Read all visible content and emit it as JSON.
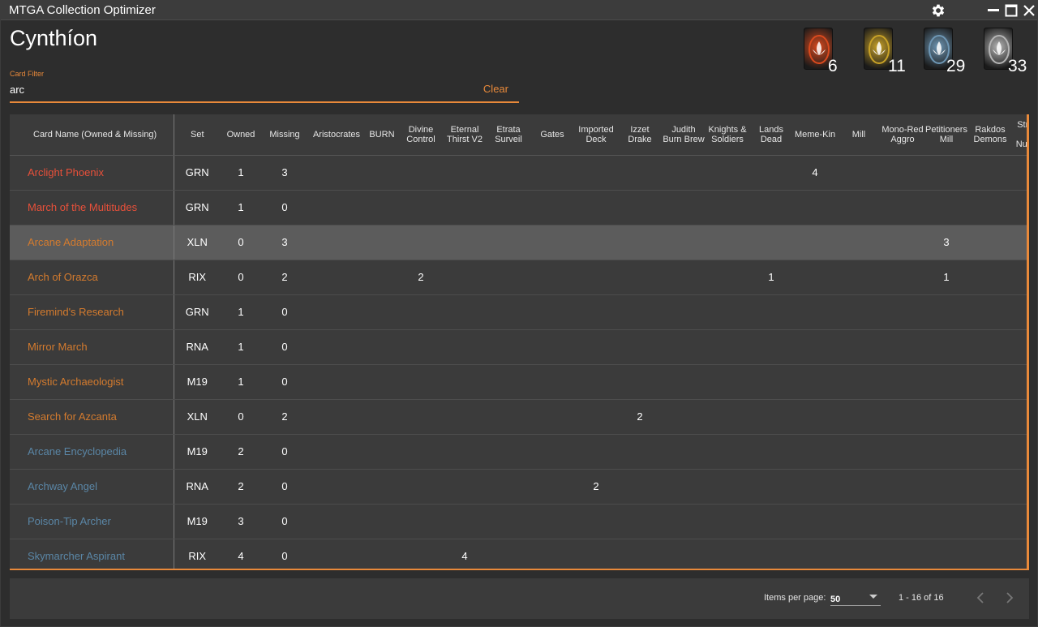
{
  "window": {
    "title": "MTGA Collection Optimizer"
  },
  "header": {
    "player_name": "Cynthíon"
  },
  "filter": {
    "label": "Card Filter",
    "value": "arc",
    "clear_label": "Clear"
  },
  "wildcards": [
    {
      "rarity": "mythic",
      "count": "6",
      "color": "#d94a1e"
    },
    {
      "rarity": "rare",
      "count": "11",
      "color": "#c9a227"
    },
    {
      "rarity": "uncommon",
      "count": "29",
      "color": "#6e97b5"
    },
    {
      "rarity": "common",
      "count": "33",
      "color": "#b5b5b5"
    }
  ],
  "table": {
    "columns": [
      {
        "label": "Card Name (Owned & Missing)"
      },
      {
        "label": "Set"
      },
      {
        "label": "Owned"
      },
      {
        "label": "Missing"
      },
      {
        "label": "Aristocrates"
      },
      {
        "label": "BURN"
      },
      {
        "label": "Divine Control"
      },
      {
        "label": "Eternal Thirst V2"
      },
      {
        "label": "Etrata Surveil"
      },
      {
        "label": "Gates"
      },
      {
        "label": "Imported Deck"
      },
      {
        "label": "Izzet Drake"
      },
      {
        "label": "Judith Burn Brew"
      },
      {
        "label": "Knights & Soldiers"
      },
      {
        "label": "Lands Dead"
      },
      {
        "label": "Meme-Kin"
      },
      {
        "label": "Mill"
      },
      {
        "label": "Mono-Red Aggro"
      },
      {
        "label": "Petitioners Mill"
      },
      {
        "label": "Rakdos Demons"
      },
      {
        "label": "Strength in Numbers"
      }
    ],
    "rows": [
      {
        "rarity": "mythic",
        "highlighted": false,
        "cells": [
          "Arclight Phoenix",
          "GRN",
          "1",
          "3",
          "",
          "",
          "",
          "",
          "",
          "",
          "",
          "",
          "",
          "",
          "",
          "4",
          "",
          "",
          "",
          "",
          ""
        ]
      },
      {
        "rarity": "mythic",
        "highlighted": false,
        "cells": [
          "March of the Multitudes",
          "GRN",
          "1",
          "0",
          "",
          "",
          "",
          "",
          "",
          "",
          "",
          "",
          "",
          "",
          "",
          "",
          "",
          "",
          "",
          "",
          ""
        ]
      },
      {
        "rarity": "rare",
        "highlighted": true,
        "cells": [
          "Arcane Adaptation",
          "XLN",
          "0",
          "3",
          "",
          "",
          "",
          "",
          "",
          "",
          "",
          "",
          "",
          "",
          "",
          "",
          "",
          "",
          "3",
          "",
          ""
        ]
      },
      {
        "rarity": "rare",
        "highlighted": false,
        "cells": [
          "Arch of Orazca",
          "RIX",
          "0",
          "2",
          "",
          "",
          "2",
          "",
          "",
          "",
          "",
          "",
          "",
          "",
          "1",
          "",
          "",
          "",
          "1",
          "",
          ""
        ]
      },
      {
        "rarity": "rare",
        "highlighted": false,
        "cells": [
          "Firemind's Research",
          "GRN",
          "1",
          "0",
          "",
          "",
          "",
          "",
          "",
          "",
          "",
          "",
          "",
          "",
          "",
          "",
          "",
          "",
          "",
          "",
          ""
        ]
      },
      {
        "rarity": "rare",
        "highlighted": false,
        "cells": [
          "Mirror March",
          "RNA",
          "1",
          "0",
          "",
          "",
          "",
          "",
          "",
          "",
          "",
          "",
          "",
          "",
          "",
          "",
          "",
          "",
          "",
          "",
          ""
        ]
      },
      {
        "rarity": "rare",
        "highlighted": false,
        "cells": [
          "Mystic Archaeologist",
          "M19",
          "1",
          "0",
          "",
          "",
          "",
          "",
          "",
          "",
          "",
          "",
          "",
          "",
          "",
          "",
          "",
          "",
          "",
          "",
          ""
        ]
      },
      {
        "rarity": "rare",
        "highlighted": false,
        "cells": [
          "Search for Azcanta",
          "XLN",
          "0",
          "2",
          "",
          "",
          "",
          "",
          "",
          "",
          "",
          "2",
          "",
          "",
          "",
          "",
          "",
          "",
          "",
          "",
          ""
        ]
      },
      {
        "rarity": "uncommon",
        "highlighted": false,
        "cells": [
          "Arcane Encyclopedia",
          "M19",
          "2",
          "0",
          "",
          "",
          "",
          "",
          "",
          "",
          "",
          "",
          "",
          "",
          "",
          "",
          "",
          "",
          "",
          "",
          ""
        ]
      },
      {
        "rarity": "uncommon",
        "highlighted": false,
        "cells": [
          "Archway Angel",
          "RNA",
          "2",
          "0",
          "",
          "",
          "",
          "",
          "",
          "",
          "2",
          "",
          "",
          "",
          "",
          "",
          "",
          "",
          "",
          "",
          ""
        ]
      },
      {
        "rarity": "uncommon",
        "highlighted": false,
        "cells": [
          "Poison-Tip Archer",
          "M19",
          "3",
          "0",
          "",
          "",
          "",
          "",
          "",
          "",
          "",
          "",
          "",
          "",
          "",
          "",
          "",
          "",
          "",
          "",
          ""
        ]
      },
      {
        "rarity": "uncommon",
        "highlighted": false,
        "cells": [
          "Skymarcher Aspirant",
          "RIX",
          "4",
          "0",
          "",
          "",
          "",
          "4",
          "",
          "",
          "",
          "",
          "",
          "",
          "",
          "",
          "",
          "",
          "",
          "",
          ""
        ]
      }
    ]
  },
  "paginator": {
    "items_per_page_label": "Items per page:",
    "items_per_page_value": "50",
    "range_label": "1 - 16 of 16"
  }
}
